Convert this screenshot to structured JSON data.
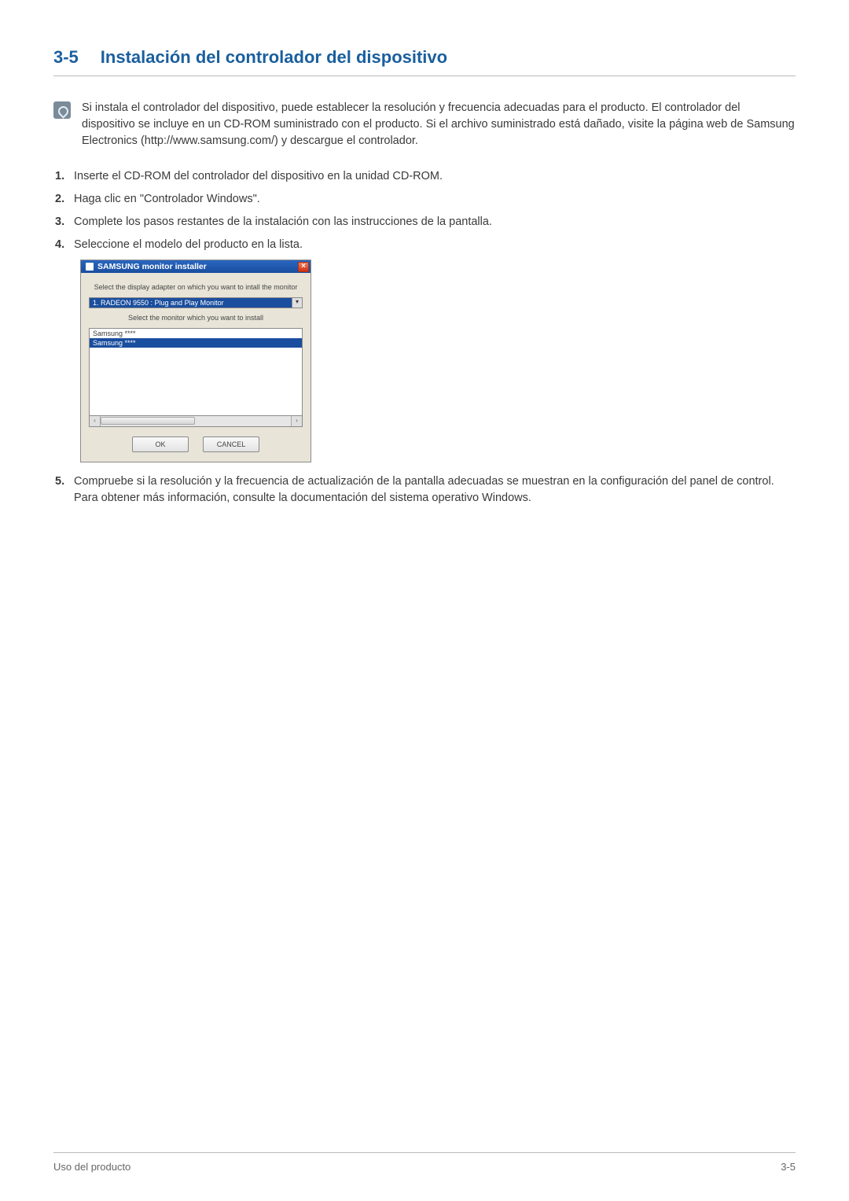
{
  "heading": {
    "number": "3-5",
    "title": "Instalación del controlador del dispositivo"
  },
  "note": "Si instala el controlador del dispositivo, puede establecer la resolución y frecuencia adecuadas para el producto. El controlador del dispositivo se incluye en un CD-ROM suministrado con el producto. Si el archivo suministrado está dañado, visite la página web de Samsung Electronics (http://www.samsung.com/) y descargue el controlador.",
  "steps": [
    "Inserte el CD-ROM del controlador del dispositivo en la unidad CD-ROM.",
    "Haga clic en \"Controlador Windows\".",
    "Complete los pasos restantes de la instalación con las instrucciones de la pantalla.",
    "Seleccione el modelo del producto en la lista.",
    "Compruebe si la resolución y la frecuencia de actualización de la pantalla adecuadas se muestran en la configuración del panel de control. Para obtener más información, consulte la documentación del sistema operativo Windows."
  ],
  "installer": {
    "title": "SAMSUNG monitor installer",
    "close": "×",
    "label_adapter": "Select the display adapter on which you want to intall the monitor",
    "adapter_value": "1. RADEON 9550 : Plug and Play Monitor",
    "dropdown_glyph": "▾",
    "label_monitor": "Select the monitor which you want to install",
    "monitors": [
      "Samsung ****",
      "Samsung ****"
    ],
    "scroll_left": "‹",
    "scroll_right": "›",
    "ok": "OK",
    "cancel": "CANCEL"
  },
  "footer": {
    "left": "Uso del producto",
    "right": "3-5"
  }
}
